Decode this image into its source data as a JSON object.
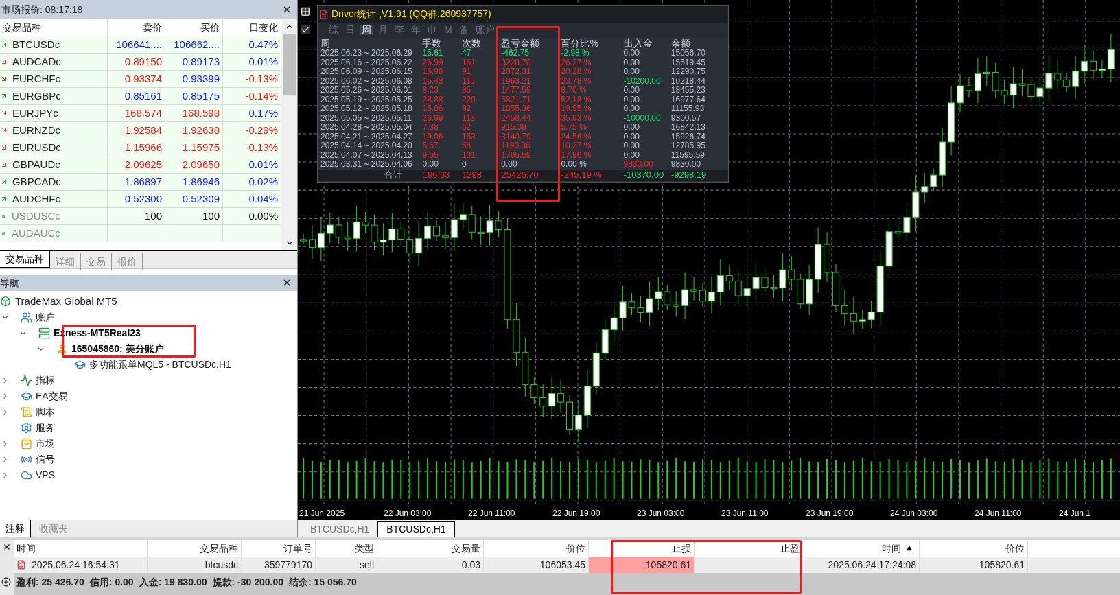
{
  "market_watch": {
    "title": "市场报价: 08:17:18",
    "columns": [
      "交易品种",
      "卖价",
      "买价",
      "日变化"
    ],
    "rows": [
      {
        "symbol": "BTCUSDc",
        "kind": "up",
        "disabled": false,
        "bid": {
          "text": "106641....",
          "color": "#1414ff"
        },
        "ask": {
          "text": "106662....",
          "color": "#1414ff"
        },
        "change": {
          "text": "0.47%",
          "color": "#1414ff"
        }
      },
      {
        "symbol": "AUDCADc",
        "kind": "down",
        "disabled": false,
        "bid": {
          "text": "0.89150",
          "color": "#ff1010"
        },
        "ask": {
          "text": "0.89173",
          "color": "#1414ff"
        },
        "change": {
          "text": "0.01%",
          "color": "#1414ff"
        }
      },
      {
        "symbol": "EURCHFc",
        "kind": "down",
        "disabled": false,
        "bid": {
          "text": "0.93374",
          "color": "#ff1010"
        },
        "ask": {
          "text": "0.93399",
          "color": "#1414ff"
        },
        "change": {
          "text": "-0.13%",
          "color": "#ff1010"
        }
      },
      {
        "symbol": "EURGBPc",
        "kind": "up",
        "disabled": false,
        "bid": {
          "text": "0.85161",
          "color": "#1414ff"
        },
        "ask": {
          "text": "0.85175",
          "color": "#1414ff"
        },
        "change": {
          "text": "-0.14%",
          "color": "#ff1010"
        }
      },
      {
        "symbol": "EURJPYc",
        "kind": "down",
        "disabled": false,
        "bid": {
          "text": "168.574",
          "color": "#ff1010"
        },
        "ask": {
          "text": "168.598",
          "color": "#ff1010"
        },
        "change": {
          "text": "0.17%",
          "color": "#1414ff"
        }
      },
      {
        "symbol": "EURNZDc",
        "kind": "down",
        "disabled": false,
        "bid": {
          "text": "1.92584",
          "color": "#ff1010"
        },
        "ask": {
          "text": "1.92638",
          "color": "#ff1010"
        },
        "change": {
          "text": "-0.29%",
          "color": "#ff1010"
        }
      },
      {
        "symbol": "EURUSDc",
        "kind": "down",
        "disabled": false,
        "bid": {
          "text": "1.15966",
          "color": "#ff1010"
        },
        "ask": {
          "text": "1.15975",
          "color": "#ff1010"
        },
        "change": {
          "text": "-0.13%",
          "color": "#ff1010"
        }
      },
      {
        "symbol": "GBPAUDc",
        "kind": "down",
        "disabled": false,
        "bid": {
          "text": "2.09625",
          "color": "#ff1010"
        },
        "ask": {
          "text": "2.09650",
          "color": "#ff1010"
        },
        "change": {
          "text": "0.01%",
          "color": "#1414ff"
        }
      },
      {
        "symbol": "GBPCADc",
        "kind": "up",
        "disabled": false,
        "bid": {
          "text": "1.86897",
          "color": "#1414ff"
        },
        "ask": {
          "text": "1.86946",
          "color": "#1414ff"
        },
        "change": {
          "text": "0.02%",
          "color": "#1414ff"
        }
      },
      {
        "symbol": "AUDCHFc",
        "kind": "up",
        "disabled": false,
        "bid": {
          "text": "0.52300",
          "color": "#1414ff"
        },
        "ask": {
          "text": "0.52309",
          "color": "#1414ff"
        },
        "change": {
          "text": "0.04%",
          "color": "#1414ff"
        }
      },
      {
        "symbol": "USDUSCc",
        "kind": "none",
        "disabled": true,
        "bid": {
          "text": "100",
          "color": "#000000"
        },
        "ask": {
          "text": "100",
          "color": "#000000"
        },
        "change": {
          "text": "0.00%",
          "color": "#000000"
        }
      },
      {
        "symbol": "AUDAUCc",
        "kind": "none",
        "disabled": true
      }
    ],
    "tabs": [
      {
        "label": "交易品种",
        "selected": true
      },
      {
        "label": "详细",
        "selected": false
      },
      {
        "label": "交易",
        "selected": false
      },
      {
        "label": "报价",
        "selected": false
      }
    ]
  },
  "navigator": {
    "title": "导航",
    "root": "TradeMax Global MT5",
    "items": [
      {
        "label": "账户",
        "kind": "accounts",
        "expanded": true,
        "bold": false,
        "children": [
          {
            "label": "Exness-MT5Real23",
            "kind": "server",
            "expanded": true,
            "bold": true,
            "children": [
              {
                "label": "165045860: 美分账户",
                "kind": "user",
                "expanded": true,
                "bold": true,
                "children": [
                  {
                    "label": "多功能跟单MQL5 - BTCUSDc,H1",
                    "kind": "expert",
                    "bold": false
                  }
                ]
              }
            ]
          }
        ]
      },
      {
        "label": "指标",
        "kind": "indicator",
        "expanded": false,
        "bold": false
      },
      {
        "label": "EA交易",
        "kind": "expert",
        "expanded": false,
        "bold": false
      },
      {
        "label": "脚本",
        "kind": "script",
        "expanded": false,
        "bold": false
      },
      {
        "label": "服务",
        "kind": "service",
        "bold": false
      },
      {
        "label": "市场",
        "kind": "market",
        "expanded": false,
        "bold": false
      },
      {
        "label": "信号",
        "kind": "signal",
        "expanded": false,
        "bold": false
      },
      {
        "label": "VPS",
        "kind": "cloud",
        "expanded": false,
        "bold": false
      }
    ],
    "tabs": [
      {
        "label": "注释",
        "selected": true
      },
      {
        "label": "收藏夹",
        "selected": false
      }
    ]
  },
  "stats_panel": {
    "title": "Driver统计 ,V1.91 (QQ群:260937757)",
    "tabs": [
      {
        "label": "综",
        "selected": false
      },
      {
        "label": "日",
        "selected": false
      },
      {
        "label": "周",
        "selected": true
      },
      {
        "label": "月",
        "selected": false
      },
      {
        "label": "李",
        "selected": false
      },
      {
        "label": "年",
        "selected": false
      },
      {
        "label": "巾",
        "selected": false
      },
      {
        "label": "M",
        "selected": false
      },
      {
        "label": "备",
        "selected": false
      },
      {
        "label": "账户",
        "selected": false
      }
    ],
    "columns": [
      "周",
      "手数",
      "次数",
      "盈亏金额",
      "百分比%",
      "出入金",
      "余额"
    ],
    "rows": [
      {
        "cells": [
          {
            "text": "2025.06.23 ~ 2025.06.29",
            "color": "#b8c4d4"
          },
          {
            "text": "15.61",
            "color": "#22e06a"
          },
          {
            "text": "47",
            "color": "#22e06a"
          },
          {
            "text": "-462.75",
            "color": "#22e06a"
          },
          {
            "text": "-2.98 %",
            "color": "#22e06a"
          },
          {
            "text": "0.00",
            "color": "#b8c4d4"
          },
          {
            "text": "15056.70",
            "color": "#b8c4d4"
          }
        ]
      },
      {
        "cells": [
          {
            "text": "2025.06.16 ~ 2025.06.22",
            "color": "#b8c4d4"
          },
          {
            "text": "26.99",
            "color": "#ff2222"
          },
          {
            "text": "161",
            "color": "#ff2222"
          },
          {
            "text": "3228.70",
            "color": "#ff2222"
          },
          {
            "text": "26.27 %",
            "color": "#ff2222"
          },
          {
            "text": "0.00",
            "color": "#b8c4d4"
          },
          {
            "text": "15519.45",
            "color": "#b8c4d4"
          }
        ]
      },
      {
        "cells": [
          {
            "text": "2025.06.09 ~ 2025.06.15",
            "color": "#b8c4d4"
          },
          {
            "text": "16.98",
            "color": "#ff2222"
          },
          {
            "text": "91",
            "color": "#ff2222"
          },
          {
            "text": "2072.31",
            "color": "#ff2222"
          },
          {
            "text": "20.28 %",
            "color": "#ff2222"
          },
          {
            "text": "0.00",
            "color": "#b8c4d4"
          },
          {
            "text": "12290.75",
            "color": "#b8c4d4"
          }
        ]
      },
      {
        "cells": [
          {
            "text": "2025.06.02 ~ 2025.06.08",
            "color": "#b8c4d4"
          },
          {
            "text": "15.43",
            "color": "#ff2222"
          },
          {
            "text": "115",
            "color": "#ff2222"
          },
          {
            "text": "1963.21",
            "color": "#ff2222"
          },
          {
            "text": "23.78 %",
            "color": "#ff2222"
          },
          {
            "text": "-10200.00",
            "color": "#22e06a"
          },
          {
            "text": "10218.44",
            "color": "#b8c4d4"
          }
        ]
      },
      {
        "cells": [
          {
            "text": "2025.05.26 ~ 2025.06.01",
            "color": "#b8c4d4"
          },
          {
            "text": "8.23",
            "color": "#ff2222"
          },
          {
            "text": "85",
            "color": "#ff2222"
          },
          {
            "text": "1477.59",
            "color": "#ff2222"
          },
          {
            "text": "8.70 %",
            "color": "#ff2222"
          },
          {
            "text": "0.00",
            "color": "#b8c4d4"
          },
          {
            "text": "18455.23",
            "color": "#b8c4d4"
          }
        ]
      },
      {
        "cells": [
          {
            "text": "2025.05.19 ~ 2025.05.25",
            "color": "#b8c4d4"
          },
          {
            "text": "28.88",
            "color": "#ff2222"
          },
          {
            "text": "220",
            "color": "#ff2222"
          },
          {
            "text": "5821.71",
            "color": "#ff2222"
          },
          {
            "text": "52.18 %",
            "color": "#ff2222"
          },
          {
            "text": "0.00",
            "color": "#b8c4d4"
          },
          {
            "text": "16977.64",
            "color": "#b8c4d4"
          }
        ]
      },
      {
        "cells": [
          {
            "text": "2025.05.12 ~ 2025.05.18",
            "color": "#b8c4d4"
          },
          {
            "text": "15.86",
            "color": "#ff2222"
          },
          {
            "text": "92",
            "color": "#ff2222"
          },
          {
            "text": "1855.36",
            "color": "#ff2222"
          },
          {
            "text": "19.95 %",
            "color": "#ff2222"
          },
          {
            "text": "0.00",
            "color": "#b8c4d4"
          },
          {
            "text": "11155.93",
            "color": "#b8c4d4"
          }
        ]
      },
      {
        "cells": [
          {
            "text": "2025.05.05 ~ 2025.05.11",
            "color": "#b8c4d4"
          },
          {
            "text": "26.99",
            "color": "#ff2222"
          },
          {
            "text": "113",
            "color": "#ff2222"
          },
          {
            "text": "2458.44",
            "color": "#ff2222"
          },
          {
            "text": "35.93 %",
            "color": "#ff2222"
          },
          {
            "text": "-10000.00",
            "color": "#22e06a"
          },
          {
            "text": "9300.57",
            "color": "#b8c4d4"
          }
        ]
      },
      {
        "cells": [
          {
            "text": "2025.04.28 ~ 2025.05.04",
            "color": "#b8c4d4"
          },
          {
            "text": "7.38",
            "color": "#ff2222"
          },
          {
            "text": "62",
            "color": "#ff2222"
          },
          {
            "text": "915.39",
            "color": "#ff2222"
          },
          {
            "text": "5.75 %",
            "color": "#ff2222"
          },
          {
            "text": "0.00",
            "color": "#b8c4d4"
          },
          {
            "text": "16842.13",
            "color": "#b8c4d4"
          }
        ]
      },
      {
        "cells": [
          {
            "text": "2025.04.21 ~ 2025.04.27",
            "color": "#b8c4d4"
          },
          {
            "text": "19.06",
            "color": "#ff2222"
          },
          {
            "text": "153",
            "color": "#ff2222"
          },
          {
            "text": "3140.79",
            "color": "#ff2222"
          },
          {
            "text": "24.56 %",
            "color": "#ff2222"
          },
          {
            "text": "0.00",
            "color": "#b8c4d4"
          },
          {
            "text": "15926.74",
            "color": "#b8c4d4"
          }
        ]
      },
      {
        "cells": [
          {
            "text": "2025.04.14 ~ 2025.04.20",
            "color": "#b8c4d4"
          },
          {
            "text": "5.67",
            "color": "#ff2222"
          },
          {
            "text": "58",
            "color": "#ff2222"
          },
          {
            "text": "1190.36",
            "color": "#ff2222"
          },
          {
            "text": "10.27 %",
            "color": "#ff2222"
          },
          {
            "text": "0.00",
            "color": "#b8c4d4"
          },
          {
            "text": "12785.95",
            "color": "#b8c4d4"
          }
        ]
      },
      {
        "cells": [
          {
            "text": "2025.04.07 ~ 2025.04.13",
            "color": "#b8c4d4"
          },
          {
            "text": "9.55",
            "color": "#ff2222"
          },
          {
            "text": "101",
            "color": "#ff2222"
          },
          {
            "text": "1765.59",
            "color": "#ff2222"
          },
          {
            "text": "17.96 %",
            "color": "#ff2222"
          },
          {
            "text": "0.00",
            "color": "#b8c4d4"
          },
          {
            "text": "11595.59",
            "color": "#b8c4d4"
          }
        ]
      },
      {
        "cells": [
          {
            "text": "2025.03.31 ~ 2025.04.06",
            "color": "#b8c4d4"
          },
          {
            "text": "0.00",
            "color": "#b8c4d4"
          },
          {
            "text": "0",
            "color": "#b8c4d4"
          },
          {
            "text": "0.00",
            "color": "#b8c4d4"
          },
          {
            "text": "0.00 %",
            "color": "#b8c4d4"
          },
          {
            "text": "9830.00",
            "color": "#ff2222"
          },
          {
            "text": "9830.00",
            "color": "#b8c4d4"
          }
        ]
      },
      {
        "cells": [
          {
            "text": "合计",
            "color": "#b8c4d4"
          },
          {
            "text": "196.63",
            "color": "#ff2222"
          },
          {
            "text": "1298",
            "color": "#ff2222"
          },
          {
            "text": "25426.70",
            "color": "#ff2222"
          },
          {
            "text": "-245.19 %",
            "color": "#ff2222"
          },
          {
            "text": "-10370.00",
            "color": "#22e06a"
          },
          {
            "text": "-9298.19",
            "color": "#22e06a"
          }
        ],
        "kind": "total"
      }
    ]
  },
  "chart": {
    "time_labels": [
      "21 Jun 2025",
      "22 Jun 03:00",
      "22 Jun 11:00",
      "22 Jun 19:00",
      "23 Jun 03:00",
      "23 Jun 11:00",
      "23 Jun 19:00",
      "24 Jun 03:00",
      "24 Jun 11:00",
      "24 Jun 1"
    ],
    "tabs": [
      {
        "label": "BTCUSDc,H1",
        "selected": false
      },
      {
        "label": "BTCUSDc,H1",
        "selected": true
      }
    ]
  },
  "toolbox": {
    "columns": [
      {
        "label": "时间",
        "sorted": false
      },
      {
        "label": "交易品种",
        "sorted": false
      },
      {
        "label": "订单号",
        "sorted": false
      },
      {
        "label": "类型",
        "sorted": false
      },
      {
        "label": "交易量",
        "sorted": false
      },
      {
        "label": "价位",
        "sorted": false
      },
      {
        "label": "止损",
        "sorted": false
      },
      {
        "label": "止盈",
        "sorted": false
      },
      {
        "label": "时间",
        "sorted": true
      },
      {
        "label": "价位",
        "sorted": false
      }
    ],
    "row": {
      "cells": [
        "2025.06.24 16:54:31",
        "btcusdc",
        "359779170",
        "sell",
        "0.03",
        "106053.45",
        "105820.61",
        "",
        "2025.06.24 17:24:08",
        "105820.61"
      ],
      "highlight": [
        false,
        false,
        false,
        false,
        false,
        false,
        true,
        false,
        false,
        false
      ]
    },
    "summary": [
      "盈利: 25 426.70",
      "信用: 0.00",
      "入金: 19 830.00",
      "提款: -30 200.00",
      "结余: 15 056.70"
    ]
  }
}
